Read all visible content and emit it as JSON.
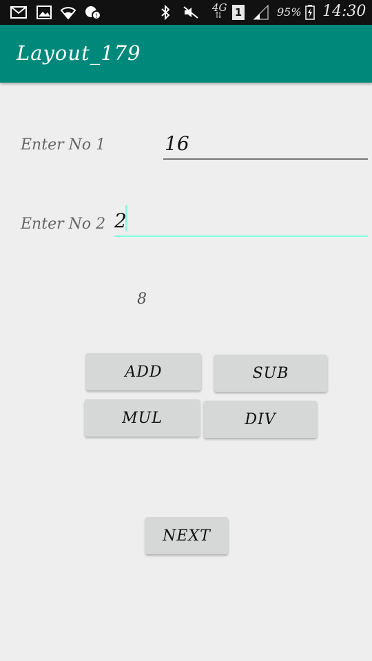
{
  "status_bar": {
    "network": "4G",
    "sim": "1",
    "battery": "95%",
    "time": "14:30",
    "icons": [
      "mail-icon",
      "image-icon",
      "wifi-icon",
      "chat-icon",
      "bluetooth-icon",
      "mute-icon",
      "signal-icon",
      "battery-icon"
    ]
  },
  "app_bar": {
    "title": "Layout_179"
  },
  "form": {
    "label_1": "Enter No 1",
    "value_1": "16",
    "label_2": "Enter No 2",
    "value_2": "2",
    "result": "8"
  },
  "buttons": {
    "add": "ADD",
    "sub": "SUB",
    "mul": "MUL",
    "div": "DIV",
    "next": "NEXT"
  },
  "colors": {
    "app_bar": "#00897b",
    "focus_underline": "#80ffe0",
    "button_bg": "#d6d7d7",
    "background": "#eeeeee"
  }
}
